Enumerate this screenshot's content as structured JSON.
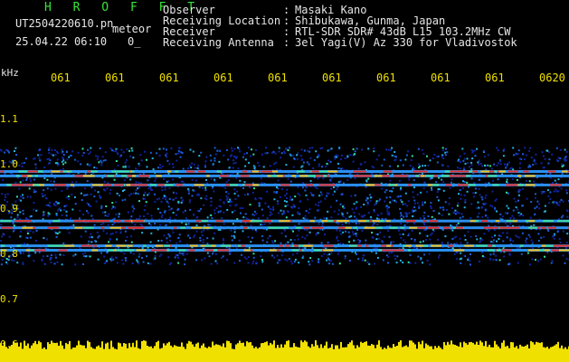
{
  "header": {
    "title": "H R O F F T",
    "filename": "UT2504220610.pn",
    "meteor_label": "meteor",
    "datetime": "25.04.22 06:10",
    "zero_label": "0_"
  },
  "info": [
    {
      "label": "Observer",
      "sep": ":",
      "value": "Masaki Kano"
    },
    {
      "label": "Receiving Location",
      "sep": ":",
      "value": "Shibukawa, Gunma, Japan"
    },
    {
      "label": "Receiver",
      "sep": ":",
      "value": "RTL-SDR SDR# 43dB L15 103.2MHz CW"
    },
    {
      "label": "Receiving Antenna",
      "sep": ":",
      "value": "3el Yagi(V) Az 330 for Vladivostok"
    }
  ],
  "axis": {
    "unit": "kHz",
    "time_ticks": [
      "061",
      "061",
      "061",
      "061",
      "061",
      "061",
      "061",
      "061",
      "061",
      "0620"
    ],
    "freq_ticks": [
      "1.1",
      "1.0",
      "0.9",
      "0.8",
      "0.7",
      "0.6"
    ]
  },
  "colors": {
    "text": "#e6e6e6",
    "title": "#37e637",
    "axis": "#f0e000",
    "amplitude": "#f0e000",
    "background": "#000000"
  },
  "chart_data": {
    "type": "heatmap",
    "x_range": [
      "06:10",
      "06:20"
    ],
    "ylabel": "kHz",
    "ylim": [
      0.6,
      1.15
    ],
    "signal_band": [
      0.78,
      1.04
    ],
    "bright_lines_khz": [
      0.985,
      0.975,
      0.955,
      0.875,
      0.86,
      0.82,
      0.81
    ]
  }
}
